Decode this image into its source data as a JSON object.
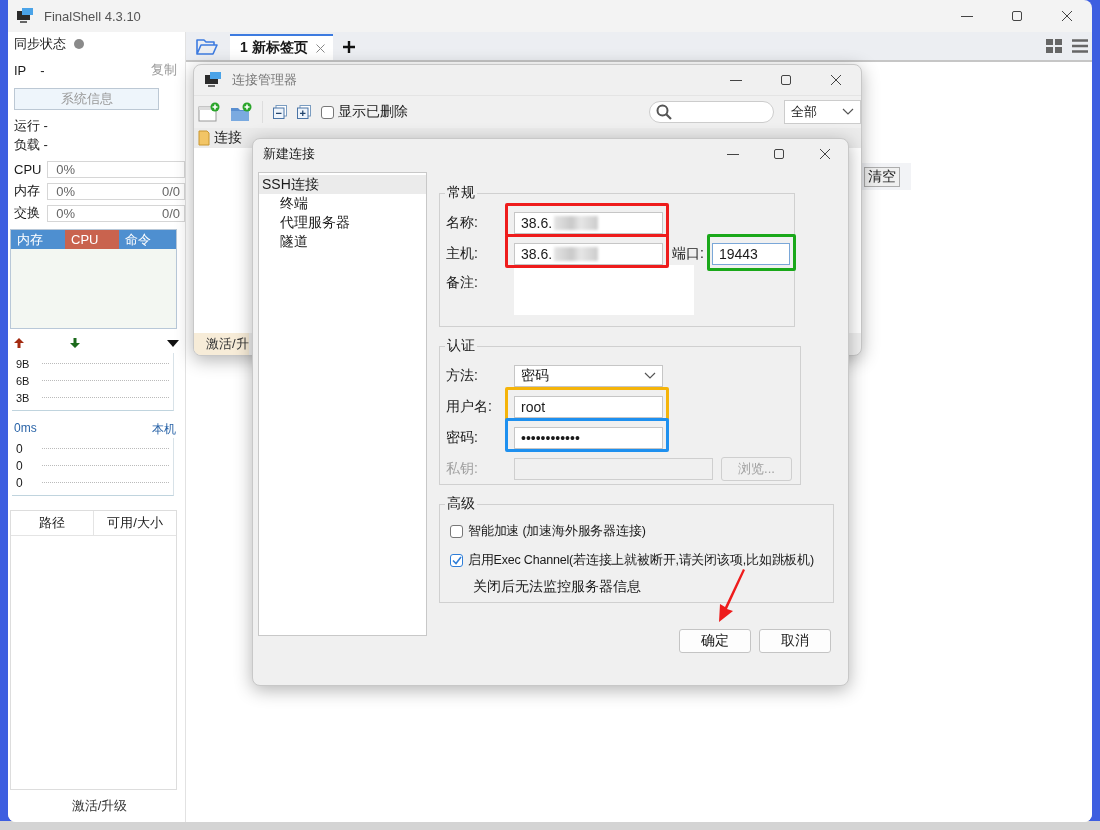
{
  "window": {
    "title": "FinalShell 4.3.10"
  },
  "sidebar": {
    "sync_label": "同步状态",
    "ip_label": "IP",
    "ip_value": "-",
    "copy": "复制",
    "sysinfo_button": "系统信息",
    "uptime": "运行 -",
    "load": "负载 -",
    "meters": [
      {
        "label": "CPU",
        "value": "0%"
      },
      {
        "label": "内存",
        "value": "0%",
        "total": "0/0"
      },
      {
        "label": "交换",
        "value": "0%",
        "total": "0/0"
      }
    ],
    "process_tabs": [
      {
        "label": "内存",
        "selected": false
      },
      {
        "label": "CPU",
        "selected": true
      },
      {
        "label": "命令",
        "selected": false
      }
    ],
    "net_ticks": [
      "9B",
      "6B",
      "3B"
    ],
    "ping": {
      "value": "0ms",
      "host": "本机",
      "ticks": [
        "0",
        "0",
        "0"
      ]
    },
    "disk_table": {
      "columns": [
        "路径",
        "可用/大小"
      ]
    },
    "footer": "激活/升级"
  },
  "tabs": [
    {
      "label": "1 新标签页",
      "selected": true
    }
  ],
  "clear_button": "清空",
  "connection_manager": {
    "title": "连接管理器",
    "show_deleted": {
      "label": "显示已删除",
      "checked": false
    },
    "filter": "全部",
    "tree": [
      {
        "label": "连接"
      }
    ],
    "footer": "激活/升"
  },
  "new_connection": {
    "title": "新建连接",
    "nav": [
      {
        "label": "SSH连接",
        "selected": true,
        "children": [
          {
            "label": "终端",
            "selected": false
          },
          {
            "label": "代理服务器",
            "selected": false
          },
          {
            "label": "隧道",
            "selected": false
          }
        ]
      }
    ],
    "general": {
      "legend": "常规",
      "name": {
        "label": "名称:",
        "value": "38.6.",
        "redacted": true,
        "color": "#ee1c1c"
      },
      "host": {
        "label": "主机:",
        "value": "38.6.",
        "redacted": true,
        "color": "#ee1c1c"
      },
      "port": {
        "label": "端口:",
        "value": "19443",
        "color": "#1aa81a"
      },
      "note": {
        "label": "备注:"
      }
    },
    "auth": {
      "legend": "认证",
      "method": {
        "label": "方法:",
        "value": "密码"
      },
      "username": {
        "label": "用户名:",
        "value": "root",
        "color": "#f5b40a"
      },
      "password": {
        "label": "密码:",
        "value": "••••••••••••",
        "color": "#1e90ef"
      },
      "private_key": {
        "label": "私钥:",
        "disabled": true
      },
      "browse": {
        "label": "浏览...",
        "disabled": true
      }
    },
    "advanced": {
      "legend": "高级",
      "options": [
        {
          "label": "智能加速 (加速海外服务器连接)",
          "checked": false
        },
        {
          "label": "启用Exec Channel(若连接上就被断开,请关闭该项,比如跳板机)",
          "checked": true
        }
      ],
      "note": "关闭后无法监控服务器信息"
    },
    "buttons": [
      {
        "label": "确定",
        "pointed": true
      },
      {
        "label": "取消",
        "pointed": false
      }
    ]
  }
}
